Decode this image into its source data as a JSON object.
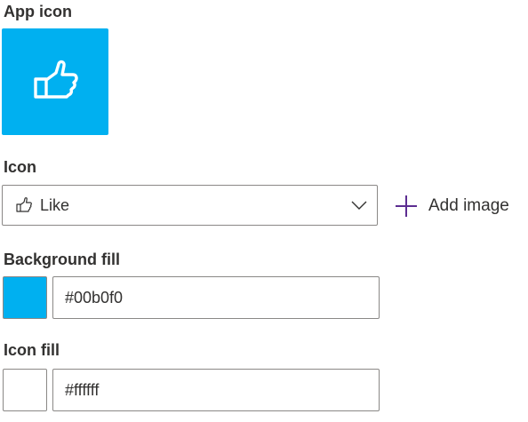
{
  "app_icon": {
    "label": "App icon",
    "icon_name": "thumbs-up-icon",
    "tile_color": "#00b0f0",
    "icon_color": "#ffffff"
  },
  "icon": {
    "label": "Icon",
    "selected_value": "Like",
    "selected_icon": "thumbs-up-icon",
    "add_image_label": "Add image",
    "add_icon_color": "#5c2d91"
  },
  "background_fill": {
    "label": "Background fill",
    "value": "#00b0f0",
    "swatch_color": "#00b0f0"
  },
  "icon_fill": {
    "label": "Icon fill",
    "value": "#ffffff",
    "swatch_color": "#ffffff"
  }
}
